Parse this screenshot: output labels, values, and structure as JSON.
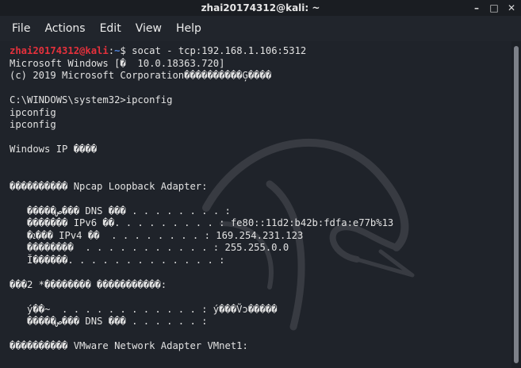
{
  "window": {
    "title": "zhai20174312@kali: ~",
    "controls": {
      "minimize": "–",
      "maximize": "□",
      "close": "✕"
    }
  },
  "menu": [
    "File",
    "Actions",
    "Edit",
    "View",
    "Help"
  ],
  "terminal": {
    "prompt_user": "zhai20174312@kali",
    "prompt_sep": ":",
    "prompt_path": "~",
    "prompt_symbol": "$",
    "command": " socat - tcp:192.168.1.106:5312",
    "output_lines": [
      "Microsoft Windows [�  10.0.18363.720]",
      "(c) 2019 Microsoft Corporation����������Ģ����",
      "",
      "C:\\WINDOWS\\system32>ipconfig",
      "ipconfig",
      "ipconfig",
      "",
      "Windows IP ����",
      "",
      "",
      "���������� Npcap Loopback Adapter:",
      "",
      "   �����ص��� DNS ��� . . . . . . . . :",
      "   ������� IPv6 ��. . . . . . . . . : fe80::11d2:b42b:fdfa:e77b%13",
      "   �ܐ��� IPv4 ��  . . . . . . . . : 169.254.231.123",
      "   ��������  . . . . . . . . . . . : 255.255.0.0",
      "   Ĭ������. . . . . . . . . . . . . :",
      "",
      "���2 *�������� �����������:",
      "",
      "   ý��~  . . . . . . . . . . . . : ý���Ṽɔ�����",
      "   �����ص��� DNS ��� . . . . . . :",
      "",
      "���������� VMware Network Adapter VMnet1:"
    ]
  },
  "icons": {
    "background_logo": "kali-dragon-icon"
  },
  "colors": {
    "terminal_bg": "#1f232a",
    "prompt_user": "#e5313c",
    "prompt_path": "#4f84e0",
    "text": "#e2e2e2"
  }
}
